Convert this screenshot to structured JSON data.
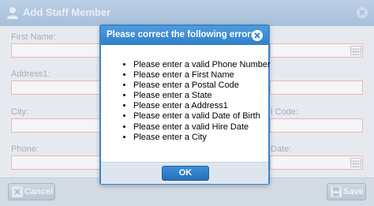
{
  "form": {
    "title": "Add Staff Member",
    "labels": {
      "first_name": "First Name:",
      "address1": "Address1:",
      "city": "City:",
      "phone": "Phone:",
      "postal_code_partial": "l Code:",
      "date_partial": "Date:"
    },
    "footer": {
      "cancel_label": "Cancel",
      "save_label": "Save"
    },
    "icons": {
      "header": "user-icon",
      "close": "close-icon",
      "calendar": "calendar-icon",
      "cancel": "cancel-icon",
      "save": "save-icon"
    }
  },
  "dialog": {
    "title": "Please correct the following errors",
    "errors": [
      "Please enter a valid Phone Number",
      "Please enter a First Name",
      "Please enter a Postal Code",
      "Please enter a State",
      "Please enter a Address1",
      "Please enter a valid Date of Birth",
      "Please enter a valid Hire Date",
      "Please enter a City"
    ],
    "ok_label": "OK",
    "accent_color": "#3a86cc"
  }
}
